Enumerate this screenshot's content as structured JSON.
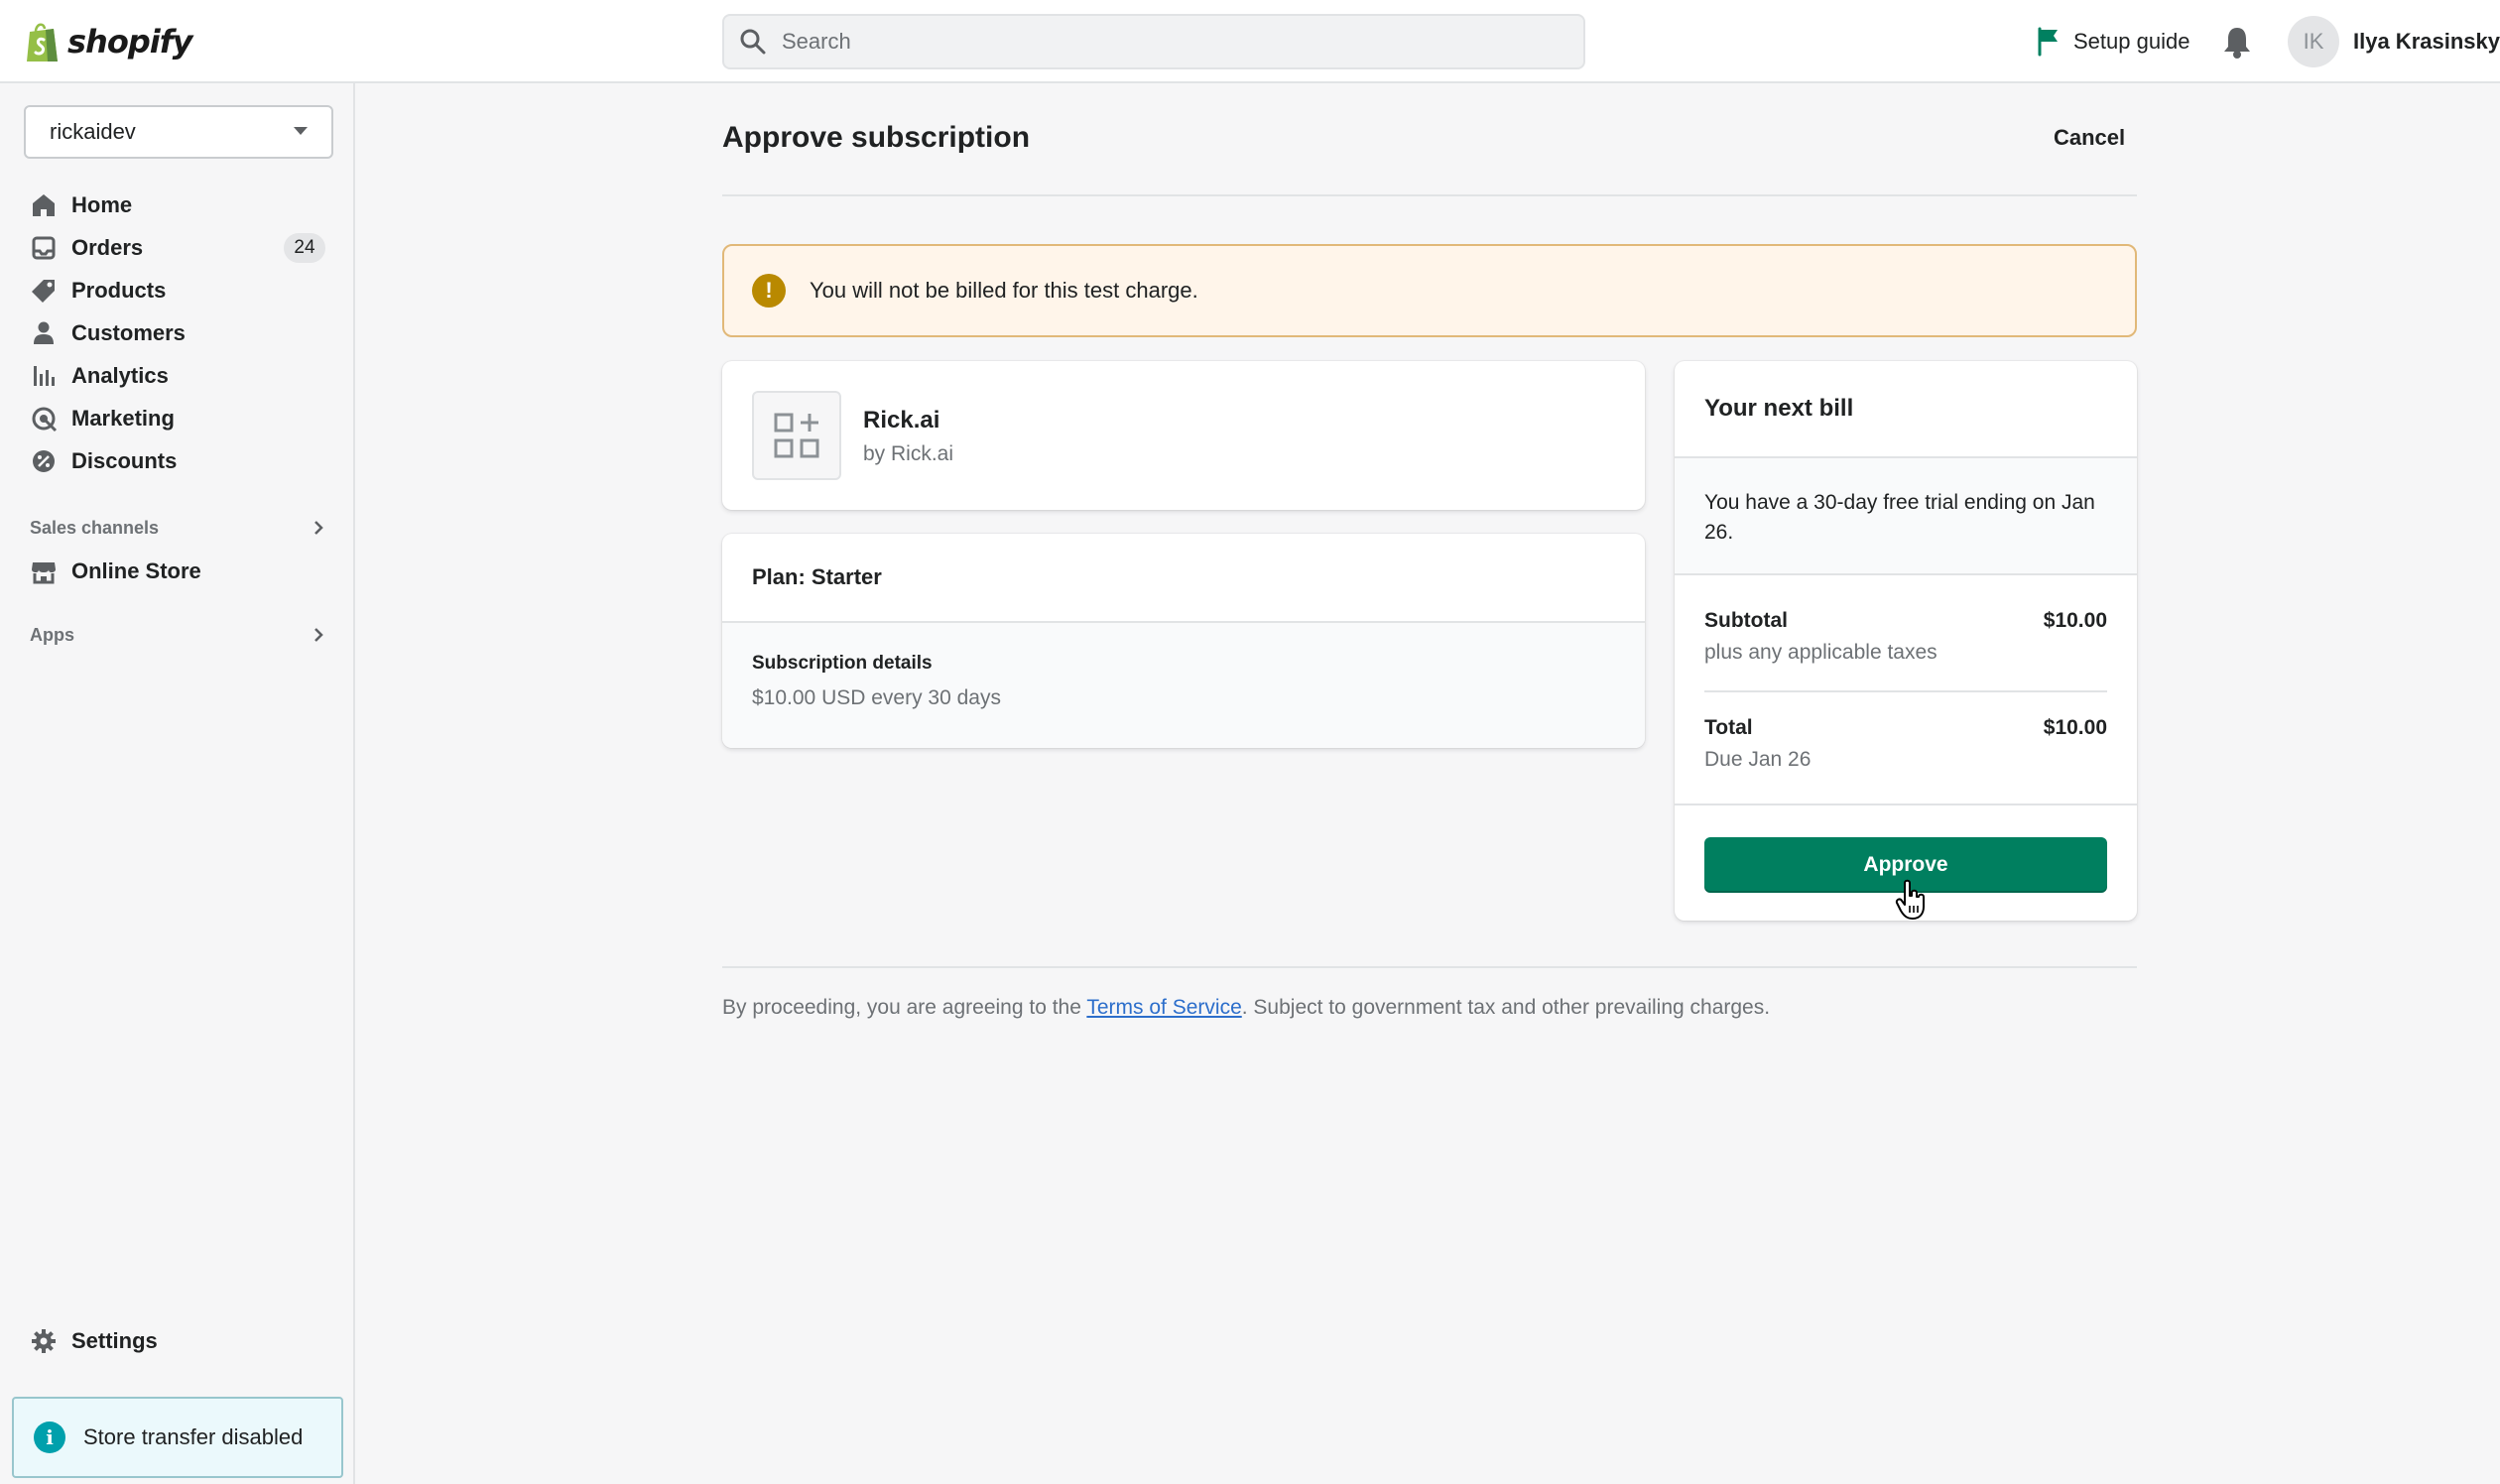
{
  "topbar": {
    "brand": "shopify",
    "search_placeholder": "Search",
    "setup_guide": "Setup guide",
    "user_initials": "IK",
    "user_name": "Ilya Krasinsky"
  },
  "sidebar": {
    "store": "rickaidev",
    "items": [
      {
        "label": "Home",
        "icon": "home-icon"
      },
      {
        "label": "Orders",
        "icon": "orders-icon",
        "badge": "24"
      },
      {
        "label": "Products",
        "icon": "tag-icon"
      },
      {
        "label": "Customers",
        "icon": "person-icon"
      },
      {
        "label": "Analytics",
        "icon": "analytics-icon"
      },
      {
        "label": "Marketing",
        "icon": "marketing-icon"
      },
      {
        "label": "Discounts",
        "icon": "discount-icon"
      }
    ],
    "sales_channels_label": "Sales channels",
    "online_store": "Online Store",
    "apps_label": "Apps",
    "settings": "Settings",
    "store_transfer": "Store transfer disabled"
  },
  "main": {
    "title": "Approve subscription",
    "cancel": "Cancel",
    "banner": "You will not be billed for this test charge.",
    "app": {
      "name": "Rick.ai",
      "by": "by Rick.ai"
    },
    "plan": {
      "name": "Plan: Starter",
      "details_label": "Subscription details",
      "details_value": "$10.00 USD every 30 days"
    },
    "bill": {
      "title": "Your next bill",
      "trial": "You have a 30-day free trial ending on Jan 26.",
      "subtotal_label": "Subtotal",
      "subtotal_amount": "$10.00",
      "subtotal_note": "plus any applicable taxes",
      "total_label": "Total",
      "total_amount": "$10.00",
      "total_note": "Due Jan 26",
      "approve": "Approve"
    },
    "footer": {
      "before": "By proceeding, you are agreeing to the ",
      "link": "Terms of Service",
      "after": ". Subject to government tax and other prevailing charges."
    }
  },
  "colors": {
    "primary": "#007f5f",
    "brand_green": "#95bf47",
    "warning": "#b98900",
    "info": "#00a0ac",
    "link": "#2c6ecb"
  }
}
